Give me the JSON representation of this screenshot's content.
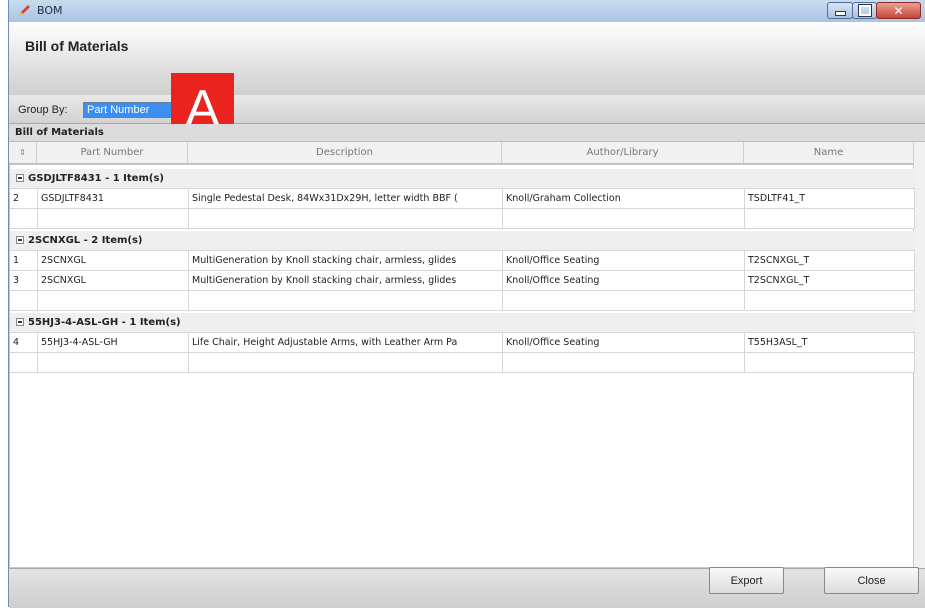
{
  "window": {
    "title": "BOM"
  },
  "header": {
    "title": "Bill of Materials"
  },
  "groupby": {
    "label": "Group By:",
    "value": "Part Number"
  },
  "annotation": {
    "badge": "A"
  },
  "grid": {
    "caption": "Bill of Materials",
    "columns": [
      "",
      "Part Number",
      "Description",
      "Author/Library",
      "Name"
    ],
    "groups": [
      {
        "header": "GSDJLTF8431 - 1 Item(s)",
        "rows": [
          [
            "2",
            "GSDJLTF8431",
            "Single Pedestal Desk, 84Wx31Dx29H, letter width BBF (",
            "Knoll/Graham Collection",
            "TSDLTF41_T"
          ]
        ]
      },
      {
        "header": "2SCNXGL - 2 Item(s)",
        "rows": [
          [
            "1",
            "2SCNXGL",
            "MultiGeneration by Knoll stacking chair, armless, glides",
            "Knoll/Office Seating",
            "T2SCNXGL_T"
          ],
          [
            "3",
            "2SCNXGL",
            "MultiGeneration by Knoll stacking chair, armless, glides",
            "Knoll/Office Seating",
            "T2SCNXGL_T"
          ]
        ]
      },
      {
        "header": "55HJ3-4-ASL-GH - 1 Item(s)",
        "rows": [
          [
            "4",
            "55HJ3-4-ASL-GH",
            "Life Chair, Height Adjustable Arms, with Leather Arm Pa",
            "Knoll/Office Seating",
            "T55H3ASL_T"
          ]
        ]
      }
    ]
  },
  "footer": {
    "export_label": "Export",
    "close_label": "Close"
  }
}
